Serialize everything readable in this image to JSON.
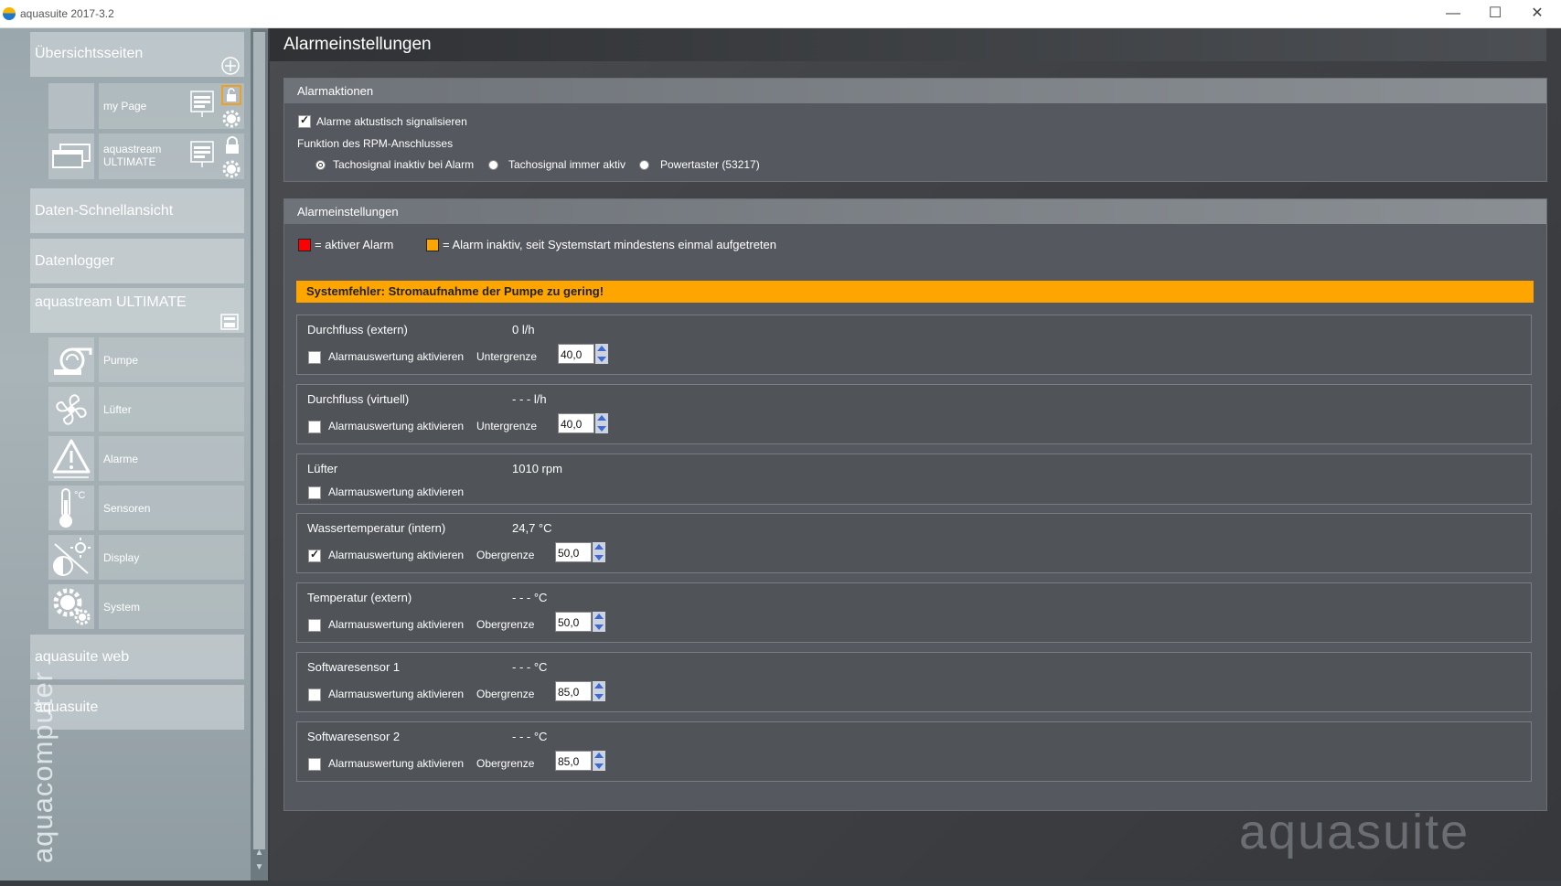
{
  "window": {
    "title": "aquasuite 2017-3.2",
    "minimize_glyph": "—",
    "maximize_glyph": "☐",
    "close_glyph": "✕"
  },
  "sidebar": {
    "overview": {
      "label": "Übersichtsseiten"
    },
    "pages": [
      {
        "label": "my Page"
      },
      {
        "label_line1": "aquastream",
        "label_line2": "ULTIMATE"
      }
    ],
    "quick_view": {
      "label": "Daten-Schnellansicht"
    },
    "datalogger": {
      "label": "Datenlogger"
    },
    "device": {
      "label": "aquastream ULTIMATE",
      "items": [
        {
          "label": "Pumpe",
          "icon": "pump-icon"
        },
        {
          "label": "Lüfter",
          "icon": "fan-icon"
        },
        {
          "label": "Alarme",
          "icon": "alarm-icon"
        },
        {
          "label": "Sensoren",
          "icon": "thermometer-icon"
        },
        {
          "label": "Display",
          "icon": "display-icon"
        },
        {
          "label": "System",
          "icon": "gears-icon"
        }
      ]
    },
    "web": {
      "label": "aquasuite web"
    },
    "suite": {
      "label": "aquasuite"
    },
    "brand": "aquacomputer"
  },
  "main": {
    "title": "Alarmeinstellungen",
    "watermark": "aquasuite",
    "actions": {
      "header": "Alarmaktionen",
      "signal_label": "Alarme aktustisch signalisieren",
      "signal_checked": true,
      "rpm_label": "Funktion des RPM-Anschlusses",
      "rpm_options": [
        {
          "label": "Tachosignal inaktiv bei Alarm",
          "selected": true
        },
        {
          "label": "Tachosignal immer aktiv",
          "selected": false
        },
        {
          "label": "Powertaster (53217)",
          "selected": false
        }
      ]
    },
    "settings": {
      "header": "Alarmeinstellungen",
      "legend_active": "= aktiver Alarm",
      "legend_inactive": "= Alarm inaktiv, seit Systemstart mindestens einmal aufgetreten",
      "legend_colors": {
        "active": "#ff0000",
        "inactive": "#ffa500"
      },
      "system_error": "Systemfehler: Stromaufnahme der Pumpe zu gering!",
      "enable_label": "Alarmauswertung aktivieren",
      "alarms": [
        {
          "name": "Durchfluss (extern)",
          "value": "0 l/h",
          "enabled": false,
          "limit_label": "Untergrenze",
          "limit": "40,0"
        },
        {
          "name": "Durchfluss (virtuell)",
          "value": "- - - l/h",
          "enabled": false,
          "limit_label": "Untergrenze",
          "limit": "40,0"
        },
        {
          "name": "Lüfter",
          "value": "1010 rpm",
          "enabled": false
        },
        {
          "name": "Wassertemperatur (intern)",
          "value": "24,7 °C",
          "enabled": true,
          "limit_label": "Obergrenze",
          "limit": "50,0"
        },
        {
          "name": "Temperatur (extern)",
          "value": "- - - °C",
          "enabled": false,
          "limit_label": "Obergrenze",
          "limit": "50,0"
        },
        {
          "name": "Softwaresensor 1",
          "value": "- - - °C",
          "enabled": false,
          "limit_label": "Obergrenze",
          "limit": "85,0"
        },
        {
          "name": "Softwaresensor 2",
          "value": "- - - °C",
          "enabled": false,
          "limit_label": "Obergrenze",
          "limit": "85,0"
        }
      ]
    }
  }
}
